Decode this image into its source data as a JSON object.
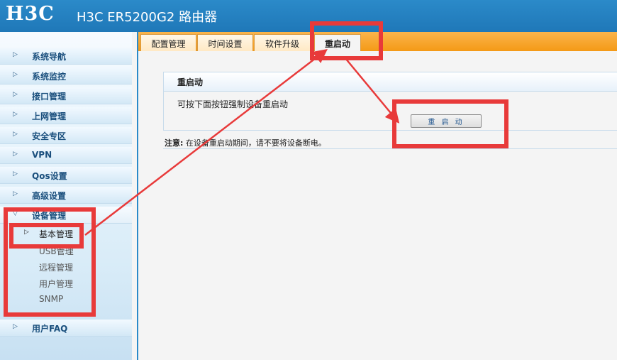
{
  "header": {
    "logo": "H3C",
    "title": "H3C ER5200G2 路由器"
  },
  "sidebar": {
    "items": [
      {
        "label": "系统导航"
      },
      {
        "label": "系统监控"
      },
      {
        "label": "接口管理"
      },
      {
        "label": "上网管理"
      },
      {
        "label": "安全专区"
      },
      {
        "label": "VPN"
      },
      {
        "label": "Qos设置"
      },
      {
        "label": "高级设置"
      },
      {
        "label": "设备管理"
      },
      {
        "label": "用户FAQ"
      }
    ],
    "sub_items": [
      {
        "label": "基本管理"
      },
      {
        "label": "USB管理"
      },
      {
        "label": "远程管理"
      },
      {
        "label": "用户管理"
      },
      {
        "label": "SNMP"
      }
    ]
  },
  "tabs": [
    {
      "label": "配置管理"
    },
    {
      "label": "时间设置"
    },
    {
      "label": "软件升级"
    },
    {
      "label": "重启动"
    }
  ],
  "panel": {
    "title": "重启动",
    "description": "可按下面按钮强制设备重启动",
    "button_label": "重 启 动",
    "note_label": "注意:",
    "note_text": "在设备重启动期间，请不要将设备断电。"
  },
  "colors": {
    "header": "#1f78b8",
    "tabbar": "#f49a16",
    "annotation": "#e83a3a"
  }
}
